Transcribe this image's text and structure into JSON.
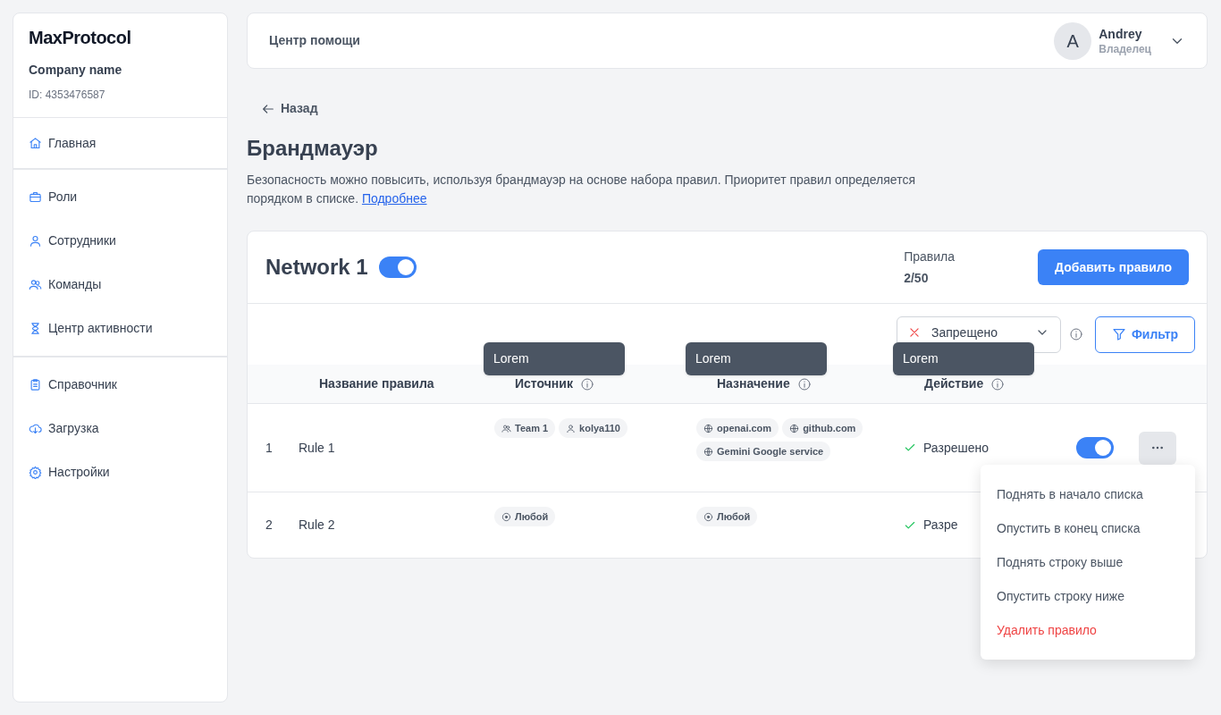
{
  "sidebar": {
    "logo": "MaxProtocol",
    "company": "Company name",
    "company_id": "ID: 4353476587",
    "groups": [
      [
        {
          "label": "Главная"
        }
      ],
      [
        {
          "label": "Роли"
        },
        {
          "label": "Сотрудники"
        },
        {
          "label": "Команды"
        },
        {
          "label": "Центр активности"
        }
      ],
      [
        {
          "label": "Справочник"
        },
        {
          "label": "Загрузка"
        },
        {
          "label": "Настройки"
        }
      ]
    ]
  },
  "header": {
    "title": "Центр помощи",
    "user": {
      "initial": "A",
      "name": "Andrey",
      "role": "Владелец"
    }
  },
  "back": "Назад",
  "page_title": "Брандмауэр",
  "description": "Безопасность можно повысить, используя брандмауэр на основе набора правил. Приоритет правил определяется порядком в списке.",
  "description_link": "Подробнее",
  "network": {
    "name": "Network 1",
    "on": true,
    "rules_label": "Правила",
    "rules_count": "2/50",
    "add_button": "Добавить правило",
    "filter_select": "Запрещено",
    "filter_button": "Фильтр",
    "columns": [
      {
        "label": "Название правила"
      },
      {
        "label": "Источник",
        "tooltip": "Lorem"
      },
      {
        "label": "Назначение",
        "tooltip": "Lorem"
      },
      {
        "label": "Действие",
        "tooltip": "Lorem"
      }
    ],
    "rows": [
      {
        "index": "1",
        "name": "Rule 1",
        "source": [
          {
            "kind": "team",
            "label": "Team 1"
          },
          {
            "kind": "user",
            "label": "kolya110"
          }
        ],
        "destination": [
          {
            "kind": "globe",
            "label": "openai.com"
          },
          {
            "kind": "globe",
            "label": "github.com"
          },
          {
            "kind": "globe",
            "label": "Gemini Google service"
          }
        ],
        "action": "Разрешено",
        "on": true,
        "menu": [
          {
            "label": "Поднять в начало списка",
            "kind": "normal"
          },
          {
            "label": "Опустить в конец списка",
            "kind": "normal"
          },
          {
            "label": "Поднять строку выше",
            "kind": "normal"
          },
          {
            "label": "Опустить строку ниже",
            "kind": "normal"
          },
          {
            "label": "Удалить правило",
            "kind": "danger"
          }
        ]
      },
      {
        "index": "2",
        "name": "Rule 2",
        "source": [
          {
            "kind": "any",
            "label": "Любой"
          }
        ],
        "destination": [
          {
            "kind": "any",
            "label": "Любой"
          }
        ],
        "action": "Разре"
      }
    ]
  }
}
